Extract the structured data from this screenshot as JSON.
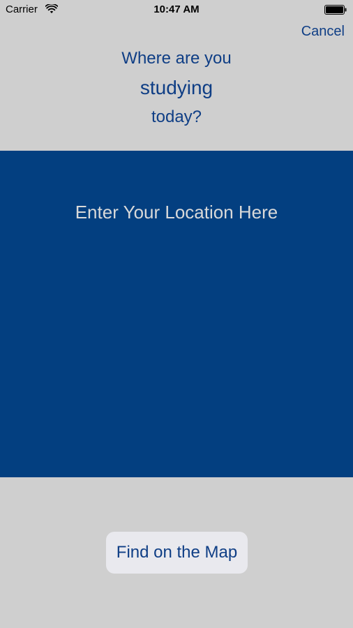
{
  "status_bar": {
    "carrier": "Carrier",
    "time": "10:47 AM",
    "wifi_icon": "wifi-icon",
    "battery_icon": "battery-icon"
  },
  "header": {
    "cancel_label": "Cancel",
    "prompt_line_1": "Where are you",
    "prompt_line_2": "studying",
    "prompt_line_3": "today?"
  },
  "location": {
    "placeholder": "Enter Your Location Here",
    "value": ""
  },
  "actions": {
    "find_on_map_label": "Find on the Map"
  },
  "colors": {
    "background": "#cfcfcf",
    "panel": "#033f80",
    "accent": "#0f3e85",
    "button_bg": "#e9e9ee"
  }
}
